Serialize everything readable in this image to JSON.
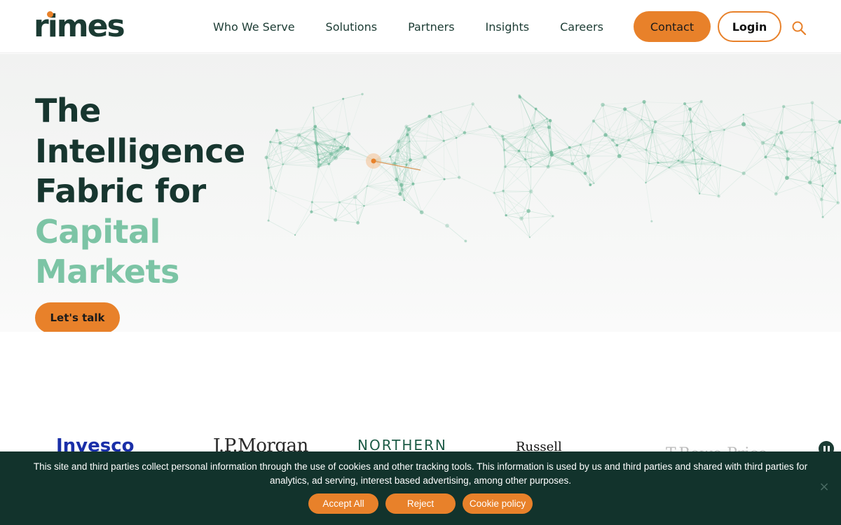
{
  "header": {
    "logo_text": "rimes",
    "nav": [
      "Who We Serve",
      "Solutions",
      "Partners",
      "Insights",
      "Careers"
    ],
    "contact_label": "Contact",
    "login_label": "Login",
    "search_icon": "search-icon"
  },
  "hero": {
    "title_lines": [
      "The",
      "Intelligence",
      "Fabric for"
    ],
    "title_highlight_lines": [
      "Capital",
      "Markets"
    ],
    "cta_label": "Let's talk"
  },
  "client_logos": [
    "Invesco",
    "J.P.Morgan",
    "NORTHERN",
    "Russell",
    "T.Rowe Price"
  ],
  "cookie_banner": {
    "text": "This site and third parties collect personal information through the use of cookies and other tracking tools. This information is used by us and third parties and shared with third parties for analytics, ad serving, interest based advertising, among other purposes.",
    "accept_label": "Accept All",
    "reject_label": "Reject",
    "policy_label": "Cookie policy",
    "close_label": "×"
  },
  "colors": {
    "brand_dark": "#17362f",
    "brand_green": "#7cc4a5",
    "accent_orange": "#e8812a",
    "banner_bg": "#12332c"
  }
}
